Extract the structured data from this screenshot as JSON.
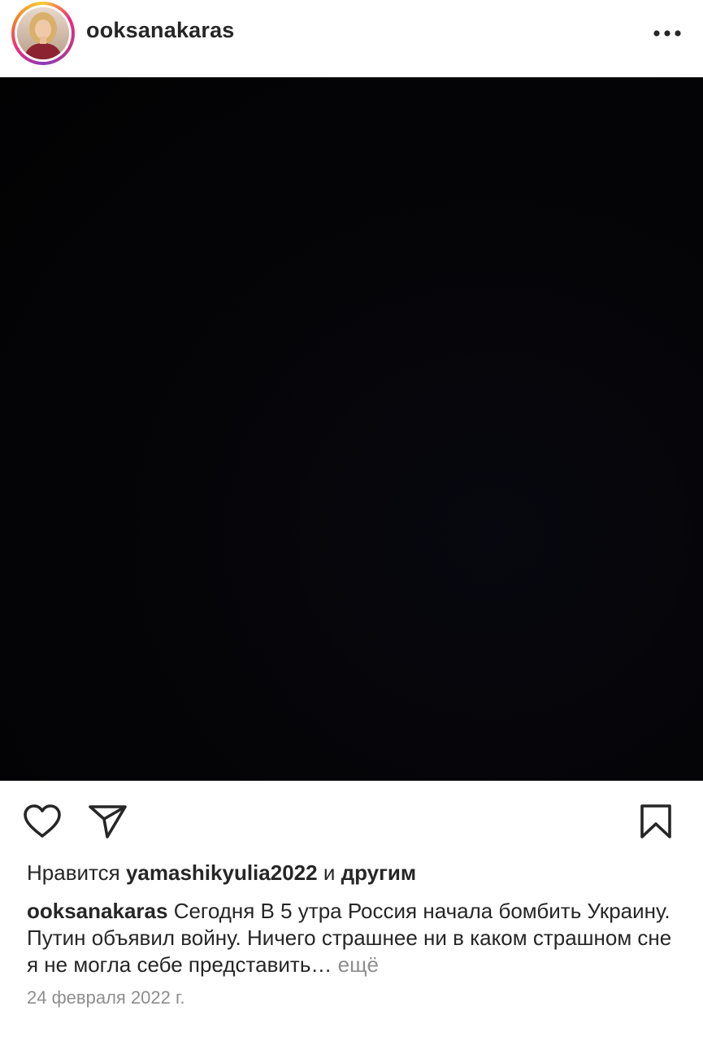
{
  "header": {
    "username": "ooksanakaras",
    "more_icon": "more-horizontal-icon"
  },
  "post": {
    "image_description_color": "#050508"
  },
  "actions": {
    "like_icon": "heart-icon",
    "share_icon": "paper-plane-icon",
    "save_icon": "bookmark-icon"
  },
  "likes": {
    "prefix": "Нравится",
    "user": "yamashikyulia2022",
    "conjunction": "и",
    "others": "другим"
  },
  "caption": {
    "username": "ooksanakaras",
    "text": "Сегодня В 5 утра Россия начала бомбить Украину. Путин объявил войну. Ничего страшнее ни в каком страшном сне я не могла себе  представить…",
    "more_label": "ещё"
  },
  "date": "24 февраля 2022 г.",
  "colors": {
    "text": "#262626",
    "secondary": "#8e8e8e",
    "story_ring": [
      "#f9ce34",
      "#ee2a7b",
      "#8a3ab9"
    ]
  }
}
